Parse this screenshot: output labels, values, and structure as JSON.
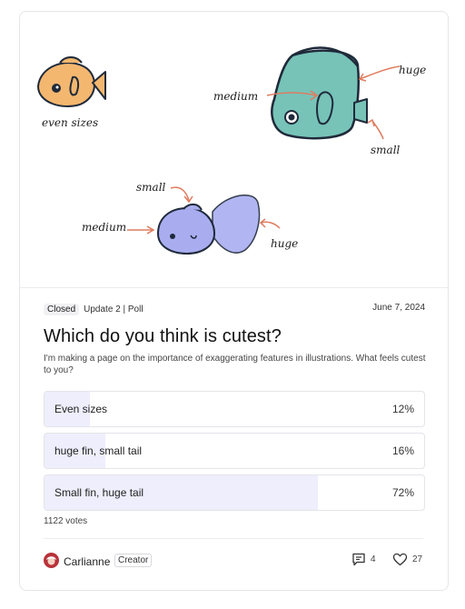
{
  "illustration": {
    "labels": {
      "even_sizes": "even sizes",
      "huge_top": "huge",
      "medium_top": "medium",
      "small_top": "small",
      "small_bottom": "small",
      "medium_bottom": "medium",
      "huge_bottom": "huge"
    }
  },
  "post": {
    "status_badge": "Closed",
    "update_info": "Update 2 | Poll",
    "date": "June 7, 2024",
    "title": "Which do you think is cutest?",
    "description": "I'm making a page on the importance of exaggerating features in illustrations. What feels cutest to you?"
  },
  "poll": {
    "options": [
      {
        "label": "Even sizes",
        "percent_text": "12%",
        "percent": 12
      },
      {
        "label": "huge fin, small tail",
        "percent_text": "16%",
        "percent": 16
      },
      {
        "label": "Small fin, huge tail",
        "percent_text": "72%",
        "percent": 72
      }
    ],
    "votes": "1122 votes"
  },
  "footer": {
    "author": "Carlianne",
    "role_badge": "Creator",
    "comments": "4",
    "likes": "27"
  },
  "colors": {
    "accent_fill": "#eeeefc",
    "avatar": "#b8323a",
    "orange_fish": "#f4b76f",
    "teal_fish": "#77c3b8",
    "lavender_fish": "#a9adf0"
  }
}
